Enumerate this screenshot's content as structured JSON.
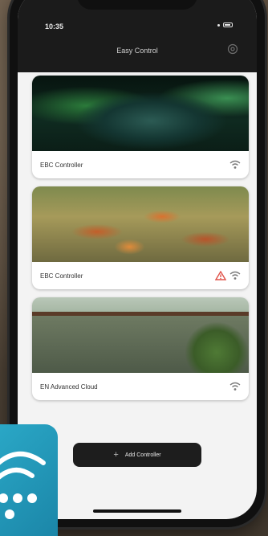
{
  "status_bar": {
    "time": "10:35"
  },
  "header": {
    "title": "Easy Control",
    "settings_icon": "gear-icon"
  },
  "controllers": [
    {
      "name": "EBC Controller",
      "image": "aquarium",
      "icons": [
        "wifi-icon"
      ]
    },
    {
      "name": "EBC Controller",
      "image": "koi-pond",
      "icons": [
        "warning-icon",
        "wifi-icon"
      ]
    },
    {
      "name": "EN Advanced Cloud",
      "image": "garden-pond",
      "icons": [
        "wifi-icon"
      ]
    }
  ],
  "add_button": {
    "label": "Add Controller",
    "icon": "plus-icon"
  },
  "colors": {
    "header_bg": "#1b1b1b",
    "accent_warning": "#e0534a",
    "badge": "#2aa7c6"
  },
  "badge": {
    "icon": "wifi-signal-icon"
  }
}
